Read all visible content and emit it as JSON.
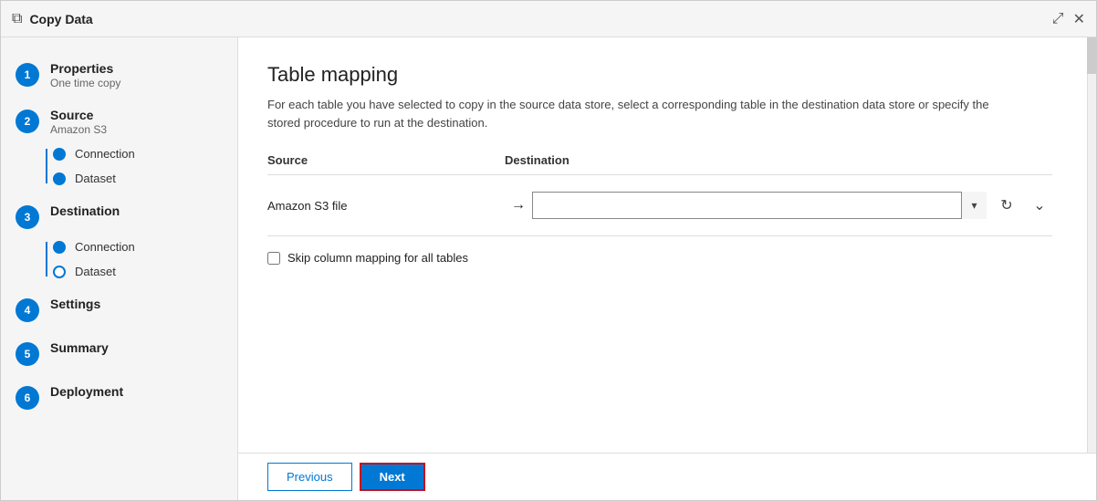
{
  "window": {
    "title": "Copy Data",
    "icon": "copy-icon"
  },
  "sidebar": {
    "steps": [
      {
        "number": "1",
        "label": "Properties",
        "sublabel": "One time copy",
        "active": false,
        "sub_items": []
      },
      {
        "number": "2",
        "label": "Source",
        "sublabel": "Amazon S3",
        "active": false,
        "sub_items": [
          {
            "label": "Connection",
            "filled": true
          },
          {
            "label": "Dataset",
            "filled": true
          }
        ]
      },
      {
        "number": "3",
        "label": "Destination",
        "sublabel": "",
        "active": false,
        "sub_items": [
          {
            "label": "Connection",
            "filled": true
          },
          {
            "label": "Dataset",
            "filled": false
          }
        ]
      },
      {
        "number": "4",
        "label": "Settings",
        "sublabel": "",
        "active": false,
        "sub_items": []
      },
      {
        "number": "5",
        "label": "Summary",
        "sublabel": "",
        "active": false,
        "sub_items": []
      },
      {
        "number": "6",
        "label": "Deployment",
        "sublabel": "",
        "active": false,
        "sub_items": []
      }
    ]
  },
  "main": {
    "title": "Table mapping",
    "description": "For each table you have selected to copy in the source data store, select a corresponding table in the destination data store or specify the stored procedure to run at the destination.",
    "table": {
      "source_header": "Source",
      "destination_header": "Destination",
      "rows": [
        {
          "source": "Amazon S3 file",
          "destination": ""
        }
      ]
    },
    "skip_checkbox_label": "Skip column mapping for all tables",
    "skip_checked": false
  },
  "footer": {
    "previous_label": "Previous",
    "next_label": "Next"
  },
  "icons": {
    "copy": "⧉",
    "expand": "⤢",
    "close": "✕",
    "arrow_right": "→",
    "chevron_down": "⌄",
    "refresh": "↻",
    "expand_row": "⌄"
  }
}
